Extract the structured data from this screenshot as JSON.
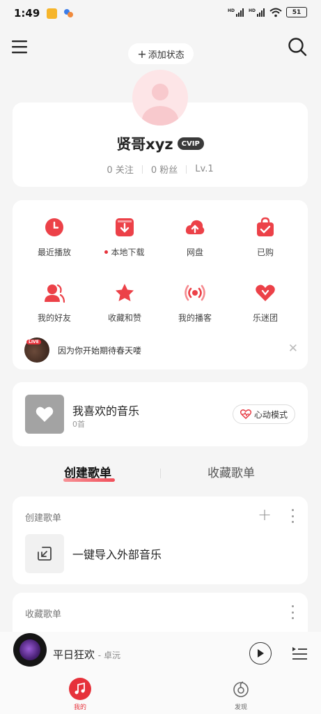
{
  "status_bar": {
    "time": "1:49",
    "battery": "51",
    "network": "HD"
  },
  "header": {
    "add_status_plus": "+",
    "add_status_label": "添加状态"
  },
  "profile": {
    "username": "贤哥xyz",
    "vip_label": "CVIP",
    "follow_count": "0",
    "follow_label": "关注",
    "fans_count": "0",
    "fans_label": "粉丝",
    "level": "Lv.1"
  },
  "quick_grid": {
    "items": [
      {
        "label": "最近播放",
        "icon": "clock-icon"
      },
      {
        "label": "本地下载",
        "icon": "download-icon"
      },
      {
        "label": "网盘",
        "icon": "cloud-upload-icon"
      },
      {
        "label": "已购",
        "icon": "shopping-bag-icon"
      },
      {
        "label": "我的好友",
        "icon": "friends-icon"
      },
      {
        "label": "收藏和赞",
        "icon": "star-icon"
      },
      {
        "label": "我的播客",
        "icon": "broadcast-icon"
      },
      {
        "label": "乐迷团",
        "icon": "fan-club-heart-icon"
      }
    ]
  },
  "live_banner": {
    "live_tag": "LIVE",
    "text": "因为你开始期待春天喽"
  },
  "liked_music": {
    "title": "我喜欢的音乐",
    "count": "0首",
    "heartbeat_label": "心动模式"
  },
  "tabs": {
    "created": "创建歌单",
    "collected": "收藏歌单"
  },
  "created_section": {
    "title": "创建歌单",
    "import_label": "一键导入外部音乐"
  },
  "collected_section": {
    "title": "收藏歌单"
  },
  "player": {
    "song": "平日狂欢",
    "artist": "- 卓沅"
  },
  "bottom_nav": {
    "mine": "我的",
    "discover": "发现"
  },
  "colors": {
    "accent": "#e6323b",
    "background": "#f5f5f5",
    "card": "#ffffff"
  }
}
